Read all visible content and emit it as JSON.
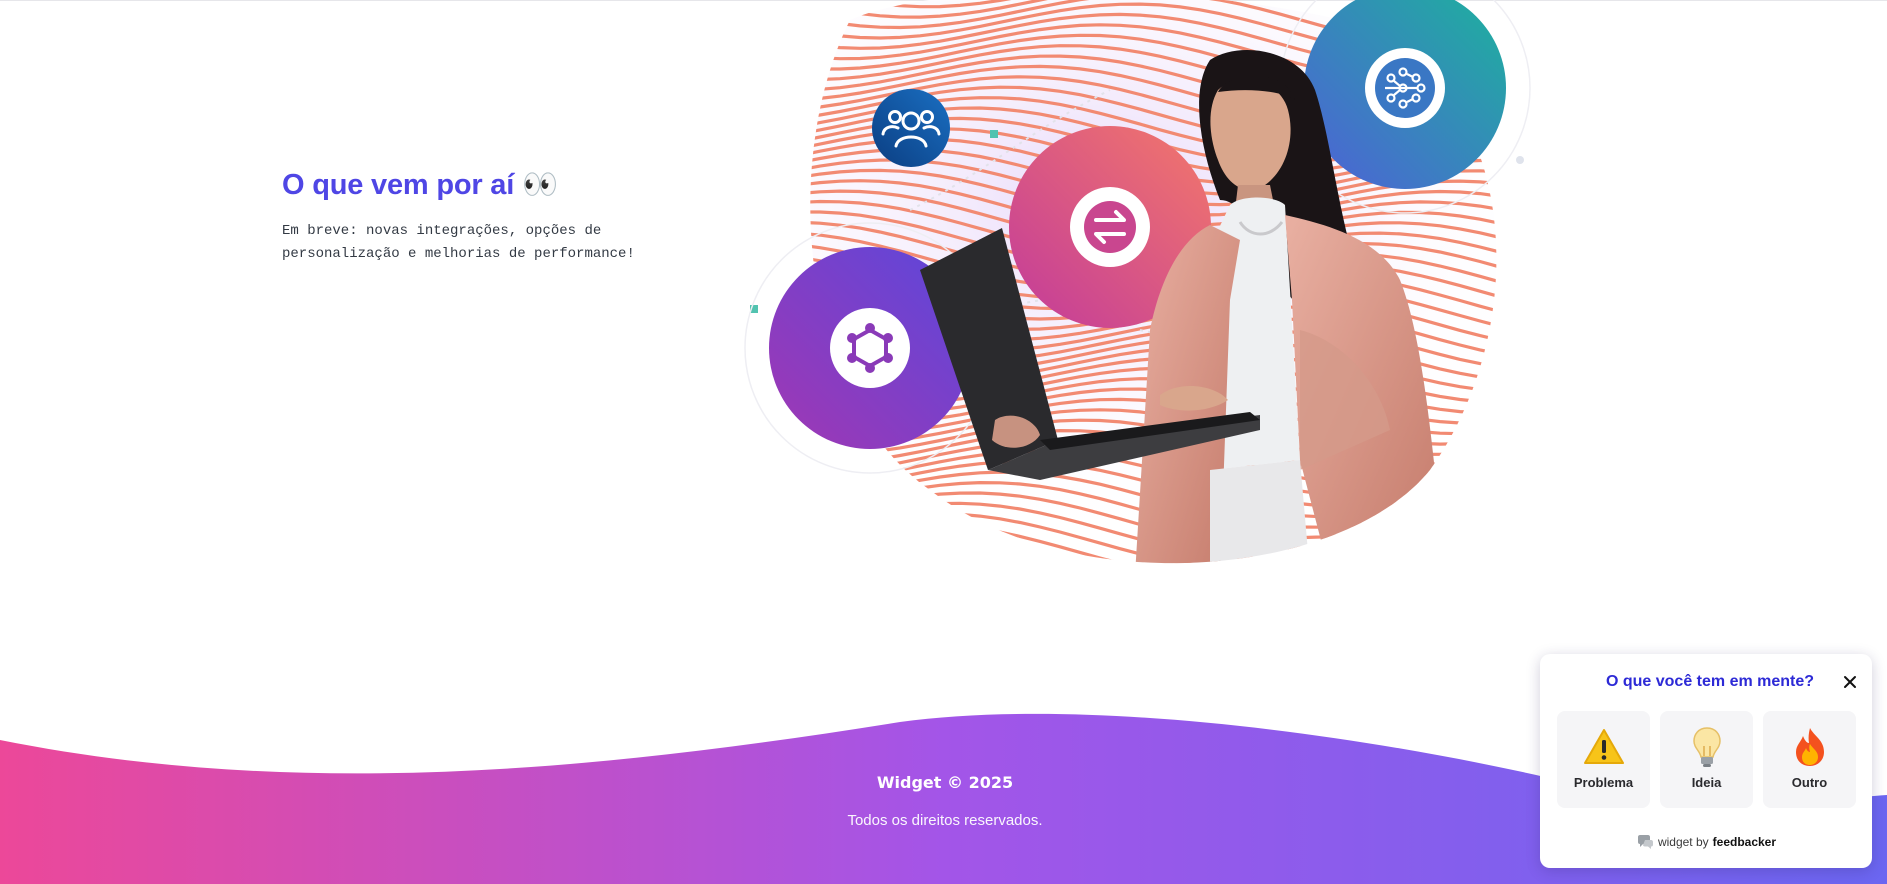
{
  "section": {
    "title": "O que vem por aí 👀",
    "description": "Em breve: novas integrações, opções de personalização e melhorias de performance!"
  },
  "illustration": {
    "icons": [
      "team-icon",
      "workflow-icon",
      "transfer-icon",
      "hub-icon"
    ]
  },
  "footer": {
    "title": "Widget © 2025",
    "subtitle": "Todos os direitos reservados."
  },
  "widget": {
    "title": "O que você tem em mente?",
    "options": [
      {
        "label": "Problema",
        "icon": "warning-icon"
      },
      {
        "label": "Ideia",
        "icon": "lightbulb-icon"
      },
      {
        "label": "Outro",
        "icon": "fire-icon"
      }
    ],
    "brand_prefix": "widget by",
    "brand_name": "feedbacker"
  },
  "colors": {
    "accent": "#4f46e5",
    "footer_gradient_start": "#ec4899",
    "footer_gradient_mid": "#a855f7",
    "footer_gradient_end": "#6366f1",
    "widget_title": "#2d2ad6"
  }
}
